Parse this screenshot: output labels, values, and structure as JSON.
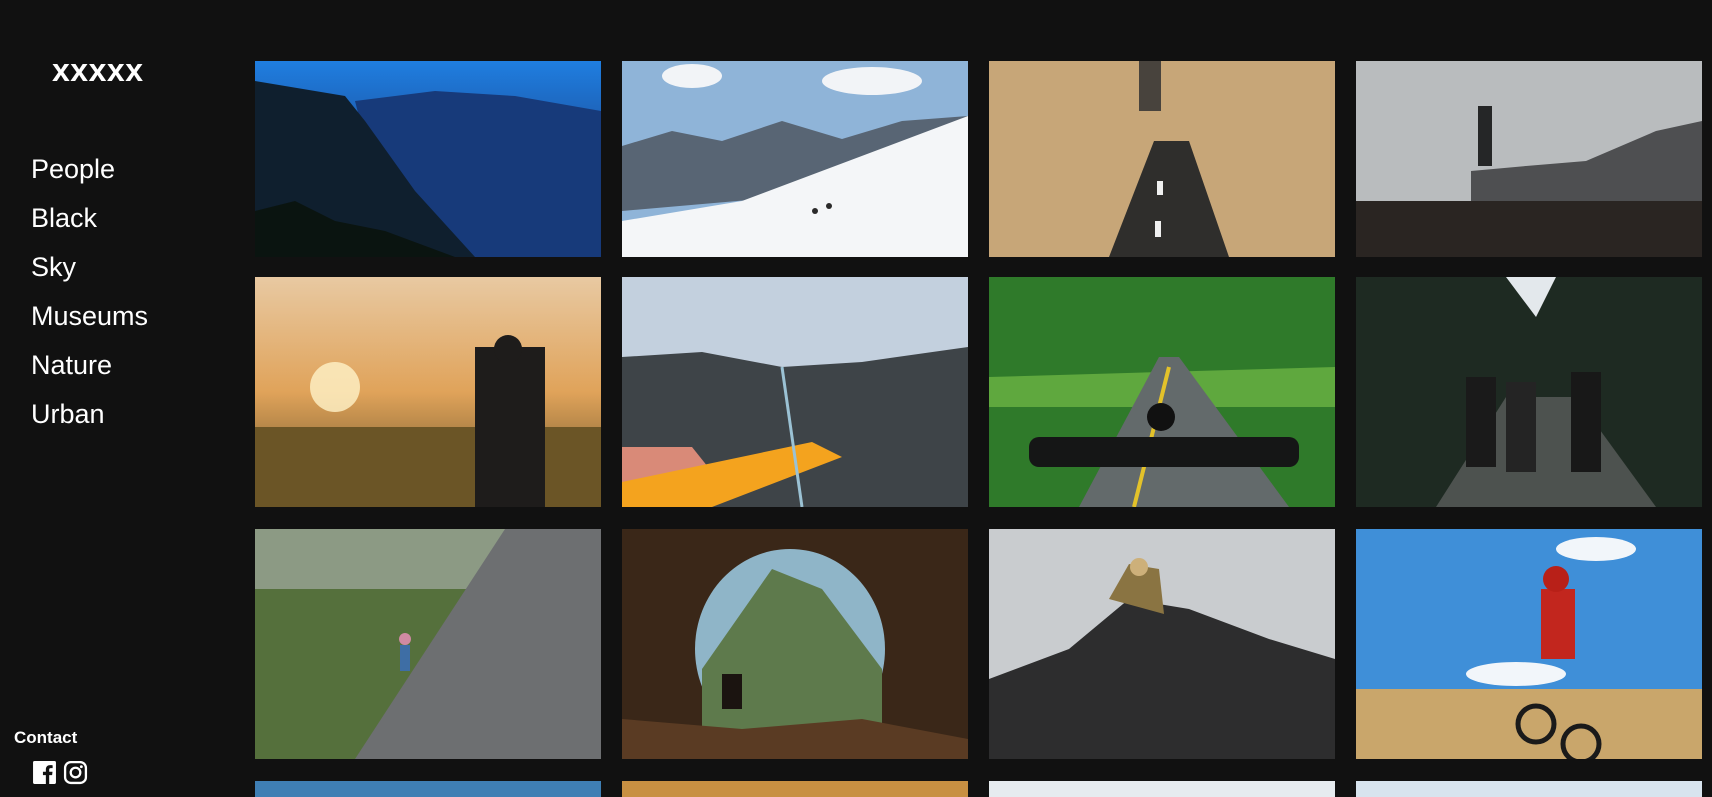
{
  "site": {
    "logo_text": "xxxxx"
  },
  "nav": {
    "items": [
      {
        "label": "People"
      },
      {
        "label": "Black"
      },
      {
        "label": "Sky"
      },
      {
        "label": "Museums"
      },
      {
        "label": "Nature"
      },
      {
        "label": "Urban"
      }
    ]
  },
  "footer": {
    "contact_label": "Contact",
    "socials": [
      {
        "icon": "facebook-icon"
      },
      {
        "icon": "instagram-icon"
      }
    ]
  },
  "gallery": {
    "photos": [
      {
        "subject": "hiker on cliff above blue mountain valley"
      },
      {
        "subject": "two skiers on snowy slope"
      },
      {
        "subject": "person on road through desert sand"
      },
      {
        "subject": "hiker standing on rock under grey sky"
      },
      {
        "subject": "backpacker in golden field at sunset"
      },
      {
        "subject": "climber rope on rock slab"
      },
      {
        "subject": "motorcycle riding forest road"
      },
      {
        "subject": "three hikers on forest trail"
      },
      {
        "subject": "climber on granite wall"
      },
      {
        "subject": "person sitting in cave mouth overlooking mountain"
      },
      {
        "subject": "hiker climbing dark rocks"
      },
      {
        "subject": "motocross rider on dirt track"
      },
      {
        "subject": "partial photo row"
      },
      {
        "subject": "partial photo row"
      },
      {
        "subject": "partial photo row"
      },
      {
        "subject": "partial photo row"
      }
    ]
  }
}
